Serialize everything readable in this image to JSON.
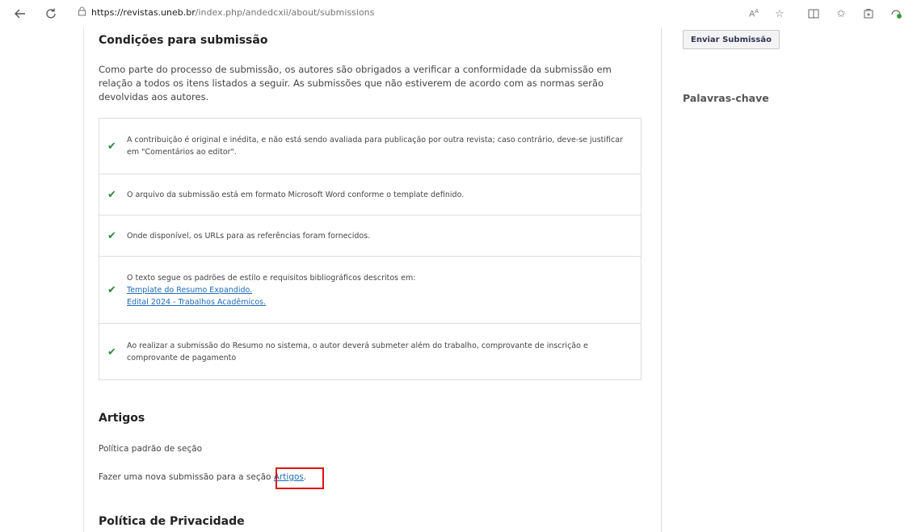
{
  "browser": {
    "url_host": "https://revistas.uneb.br",
    "url_path": "/index.php/andedcxii/about/submissions",
    "read_aloud_label": "Aᴬ"
  },
  "conditions": {
    "title": "Condições para submissão",
    "intro": "Como parte do processo de submissão, os autores são obrigados a verificar a conformidade da submissão em relação a todos os itens listados a seguir. As submissões que não estiverem de acordo com as normas serão devolvidas aos autores.",
    "items": [
      {
        "text": "A contribuição é original e inédita, e não está sendo avaliada para publicação por outra revista; caso contrário, deve-se justificar em \"Comentários ao editor\"."
      },
      {
        "text": "O arquivo da submissão está em formato Microsoft Word conforme o template definido."
      },
      {
        "text": "Onde disponível, os URLs para as referências foram fornecidos."
      },
      {
        "text": "O texto segue os padrões de estilo e requisitos bibliográficos descritos em:",
        "link1": "Template do Resumo Expandido.",
        "link2": "Edital 2024 - Trabalhos Acadêmicos."
      },
      {
        "text": "Ao realizar a submissão do Resumo no sistema, o autor deverá submeter além do trabalho, comprovante de inscrição e comprovante de pagamento"
      }
    ]
  },
  "artigos": {
    "title": "Artigos",
    "policy": "Política padrão de seção",
    "new_submission_prefix": "Fazer uma nova submissão para a seção ",
    "new_submission_link": "Artigos",
    "new_submission_suffix": "."
  },
  "privacy": {
    "title": "Política de Privacidade"
  },
  "sidebar": {
    "submit_button": "Enviar Submissão",
    "keywords_title": "Palavras-chave"
  }
}
